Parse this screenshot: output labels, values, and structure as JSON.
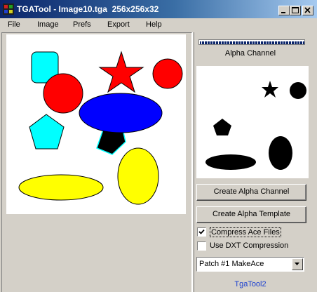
{
  "window": {
    "title": "TGATool - Image10.tga  256x256x32"
  },
  "menu": {
    "items": [
      "File",
      "Image",
      "Prefs",
      "Export",
      "Help"
    ]
  },
  "alpha_panel": {
    "label": "Alpha Channel",
    "progress_percent": 100
  },
  "buttons": {
    "create_alpha_channel": "Create Alpha Channel",
    "create_alpha_template": "Create Alpha Template"
  },
  "options": {
    "compress_ace": {
      "label": "Compress Ace Files",
      "checked": true
    },
    "use_dxt": {
      "label": "Use DXT Compression",
      "checked": false
    }
  },
  "patch_select": {
    "selected": "Patch #1 MakeAce"
  },
  "footer": {
    "text": "TgaTool2"
  },
  "colors": {
    "red": "#ff0000",
    "cyan": "#00ffff",
    "blue": "#0000ff",
    "yellow": "#ffff00",
    "black": "#000000",
    "titlebar": "#0a246a",
    "link": "#1a3fd0"
  }
}
